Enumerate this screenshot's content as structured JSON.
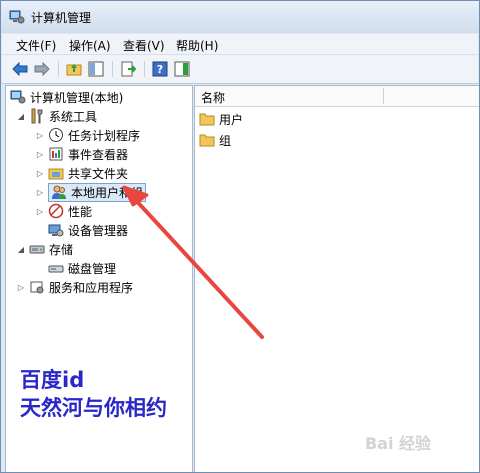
{
  "window": {
    "title": "计算机管理"
  },
  "menubar": {
    "items": [
      {
        "label": "文件(F)"
      },
      {
        "label": "操作(A)"
      },
      {
        "label": "查看(V)"
      },
      {
        "label": "帮助(H)"
      }
    ]
  },
  "toolbar": {
    "buttons": [
      {
        "icon": "back-arrow-icon"
      },
      {
        "icon": "forward-arrow-icon"
      },
      {
        "icon": "up-folder-icon"
      },
      {
        "icon": "show-hide-console-tree-icon"
      },
      {
        "icon": "export-list-icon"
      },
      {
        "icon": "help-icon"
      },
      {
        "icon": "show-action-pane-icon"
      }
    ]
  },
  "tree": {
    "root": "计算机管理(本地)",
    "items": [
      {
        "label": "系统工具",
        "icon": "tools-icon",
        "expander": "◢"
      },
      {
        "label": "任务计划程序",
        "icon": "clock-icon",
        "expander": "▷"
      },
      {
        "label": "事件查看器",
        "icon": "event-viewer-icon",
        "expander": "▷"
      },
      {
        "label": "共享文件夹",
        "icon": "shared-folder-icon",
        "expander": "▷"
      },
      {
        "label": "本地用户和组",
        "icon": "users-icon",
        "expander": "▷"
      },
      {
        "label": "性能",
        "icon": "performance-icon",
        "expander": "▷"
      },
      {
        "label": "设备管理器",
        "icon": "device-manager-icon",
        "expander": ""
      },
      {
        "label": "存储",
        "icon": "storage-icon",
        "expander": "◢"
      },
      {
        "label": "磁盘管理",
        "icon": "disk-icon",
        "expander": ""
      },
      {
        "label": "服务和应用程序",
        "icon": "services-icon",
        "expander": "▷"
      }
    ]
  },
  "list": {
    "header": "名称",
    "items": [
      {
        "label": "用户",
        "icon": "folder-icon"
      },
      {
        "label": "组",
        "icon": "folder-icon"
      }
    ]
  },
  "watermark": {
    "line1": "百度id",
    "line2": "天然河与你相约"
  },
  "colors": {
    "accent_text": "#2a27c9",
    "arrow": "#e8463f",
    "selection": "#dbe8f8"
  }
}
